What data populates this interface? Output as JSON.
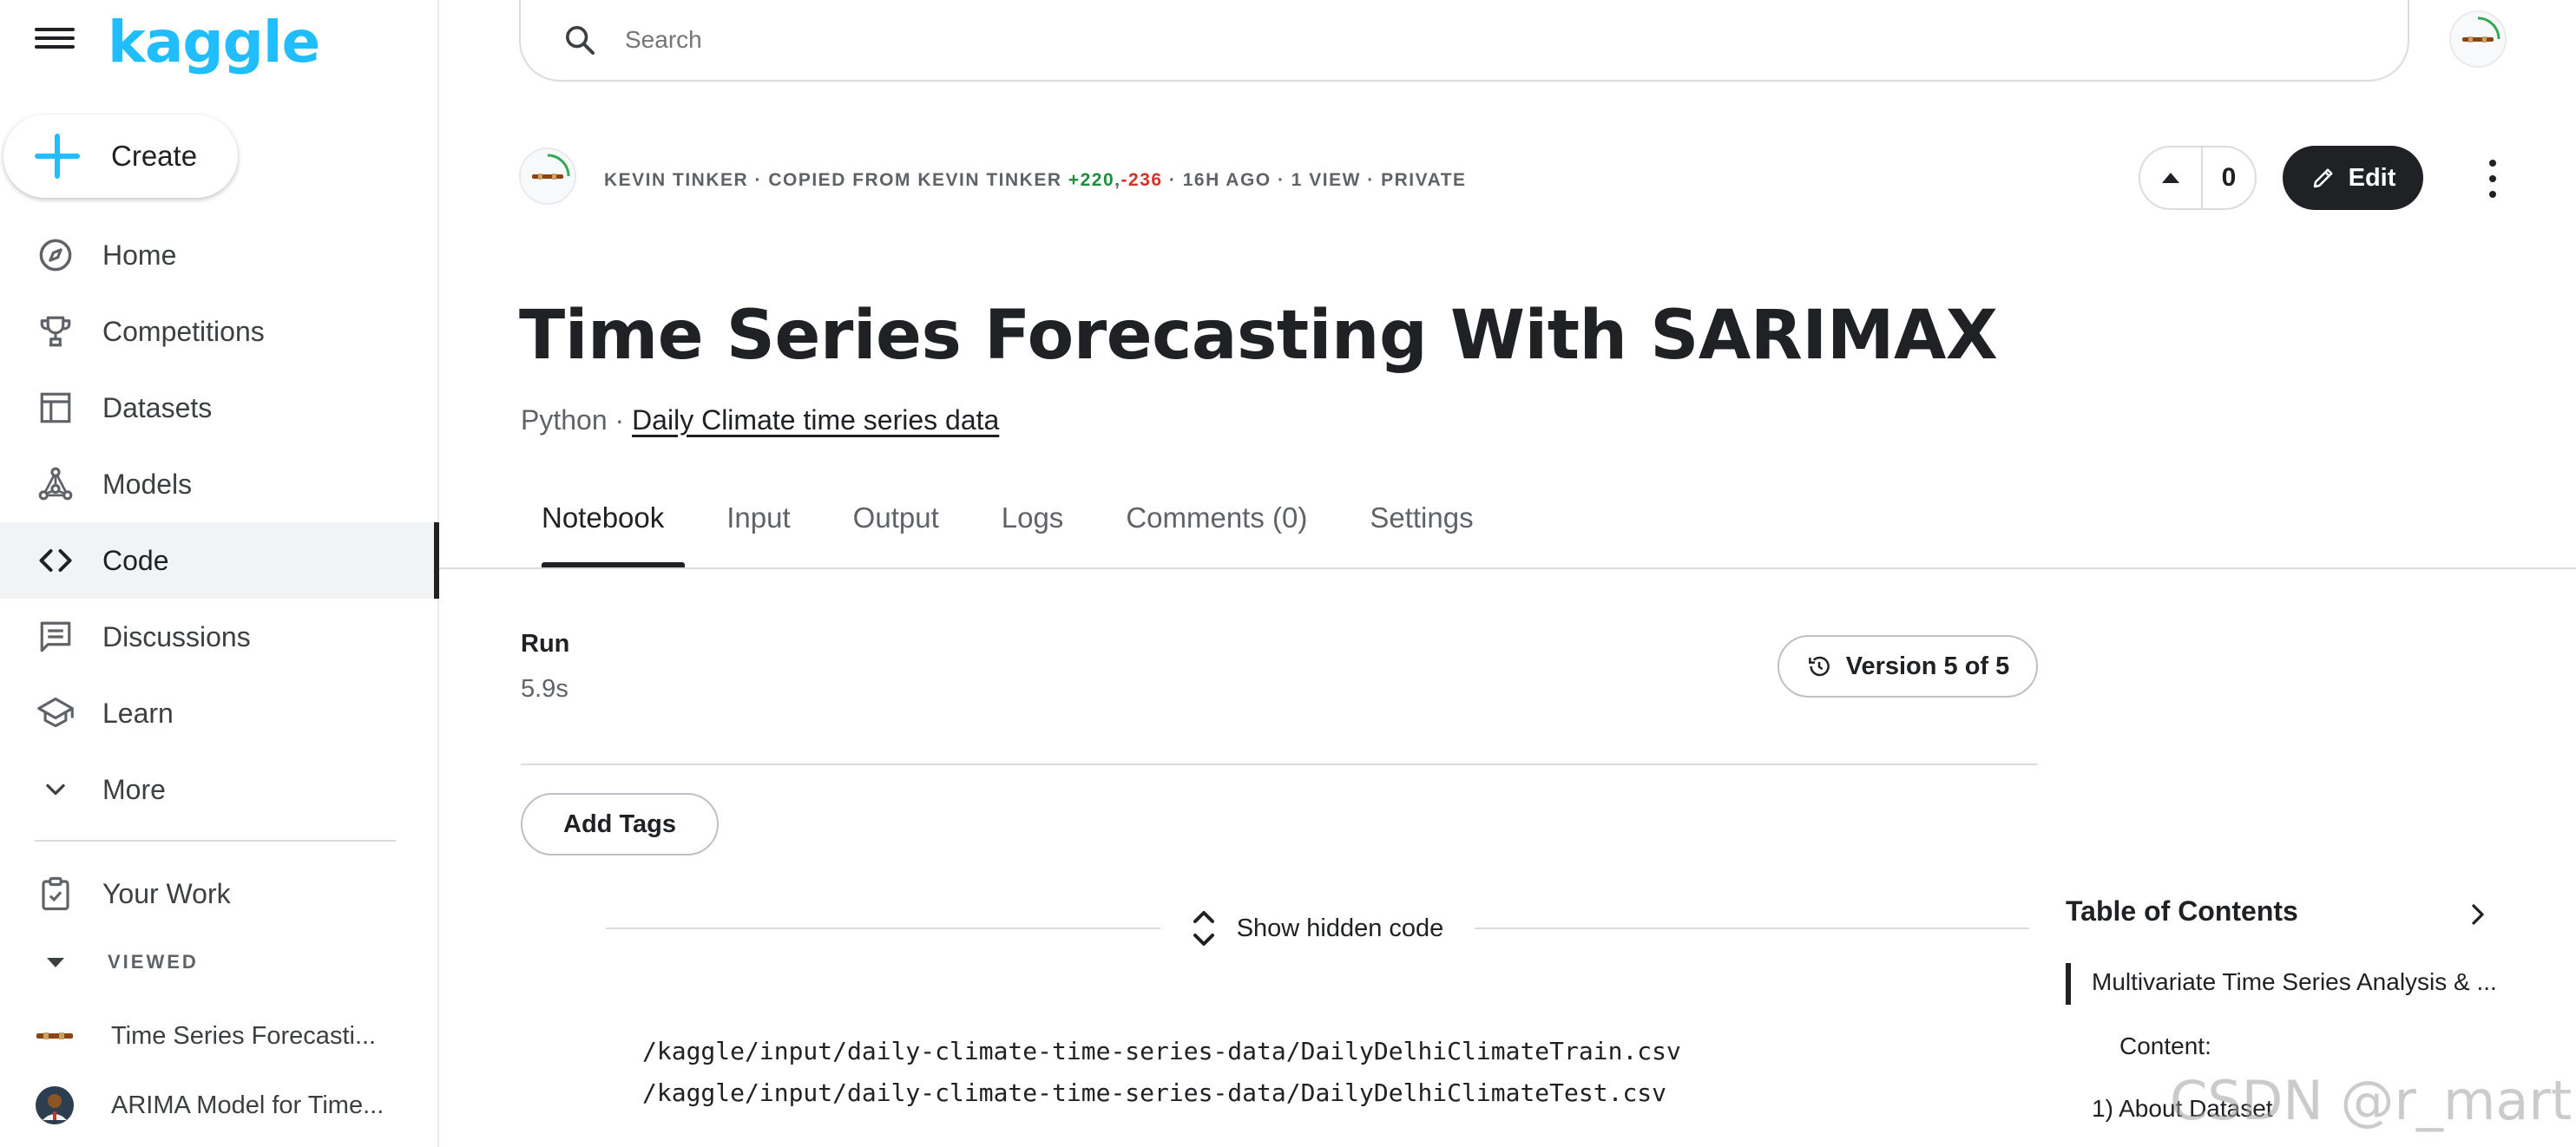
{
  "sidebar": {
    "logo": "kaggle",
    "create_label": "Create",
    "nav": [
      {
        "label": "Home",
        "icon": "compass-icon"
      },
      {
        "label": "Competitions",
        "icon": "trophy-icon"
      },
      {
        "label": "Datasets",
        "icon": "table-icon"
      },
      {
        "label": "Models",
        "icon": "models-icon"
      },
      {
        "label": "Code",
        "icon": "code-icon",
        "active": true
      },
      {
        "label": "Discussions",
        "icon": "comment-icon"
      },
      {
        "label": "Learn",
        "icon": "school-icon"
      },
      {
        "label": "More",
        "icon": "chevron-down-icon"
      }
    ],
    "your_work": "Your Work",
    "viewed_heading": "VIEWED",
    "viewed": [
      {
        "label": "Time Series Forecasti..."
      },
      {
        "label": "ARIMA Model for Time..."
      }
    ]
  },
  "search": {
    "placeholder": "Search"
  },
  "meta": {
    "prefix": "KEVIN TINKER · COPIED FROM KEVIN TINKER ",
    "plus": "+220",
    "comma": ",",
    "minus": "-236",
    "suffix": " · 16H AGO · 1 VIEW · PRIVATE"
  },
  "vote": {
    "count": "0"
  },
  "edit_label": "Edit",
  "title": "Time Series Forecasting With SARIMAX",
  "subtitle": {
    "language": "Python · ",
    "dataset": "Daily Climate time series data"
  },
  "tabs": [
    "Notebook",
    "Input",
    "Output",
    "Logs",
    "Comments (0)",
    "Settings"
  ],
  "run": {
    "label": "Run",
    "time": "5.9s"
  },
  "version_label": "Version 5 of 5",
  "add_tags_label": "Add Tags",
  "hidden_code_label": "Show hidden code",
  "output_lines": [
    "/kaggle/input/daily-climate-time-series-data/DailyDelhiClimateTrain.csv",
    "/kaggle/input/daily-climate-time-series-data/DailyDelhiClimateTest.csv"
  ],
  "toc": {
    "title": "Table of Contents",
    "items": [
      "Multivariate Time Series Analysis & ...",
      "Content:",
      "1) About Dataset"
    ]
  },
  "watermark": "CSDN @r_martian",
  "colors": {
    "brand": "#20beff",
    "positive": "#1e8e3e",
    "negative": "#d93025",
    "dark": "#202124"
  }
}
